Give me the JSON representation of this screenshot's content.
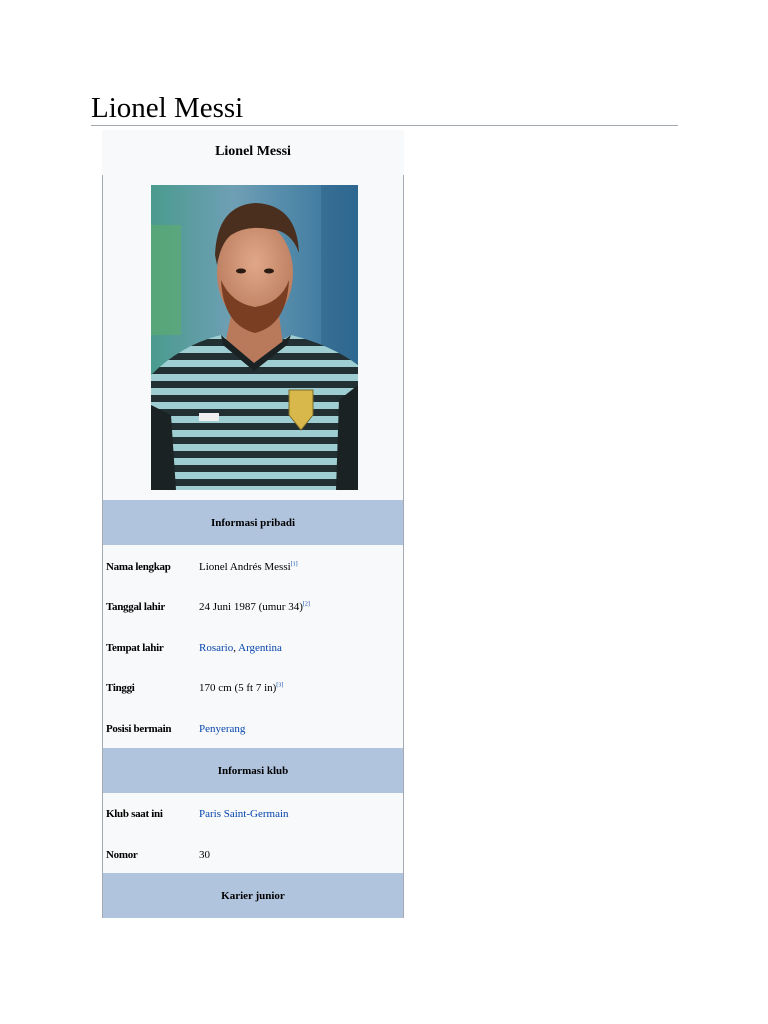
{
  "page": {
    "title": "Lionel Messi"
  },
  "infobox": {
    "caption": "Lionel Messi",
    "image_alt": "Lionel Messi",
    "sections": {
      "personal": "Informasi pribadi",
      "club": "Informasi klub",
      "youth": "Karier junior"
    },
    "rows": {
      "full_name": {
        "label": "Nama lengkap",
        "value": "Lionel Andrés Messi",
        "ref": "[1]"
      },
      "birth_date": {
        "label": "Tanggal lahir",
        "value": "24 Juni 1987 (umur 34)",
        "ref": "[2]"
      },
      "birth_place": {
        "label": "Tempat lahir",
        "city": "Rosario",
        "sep": ", ",
        "country": "Argentina"
      },
      "height": {
        "label": "Tinggi",
        "value": "170 cm (5 ft 7 in)",
        "ref": "[3]"
      },
      "position": {
        "label": "Posisi bermain",
        "value": "Penyerang"
      },
      "current_club": {
        "label": "Klub saat ini",
        "value": "Paris Saint-Germain"
      },
      "number": {
        "label": "Nomor",
        "value": "30"
      }
    }
  },
  "colors": {
    "section_bg": "#b0c4de",
    "link": "#0645ad",
    "infobox_bg": "#f8f9fa",
    "border": "#a2a9b1"
  }
}
